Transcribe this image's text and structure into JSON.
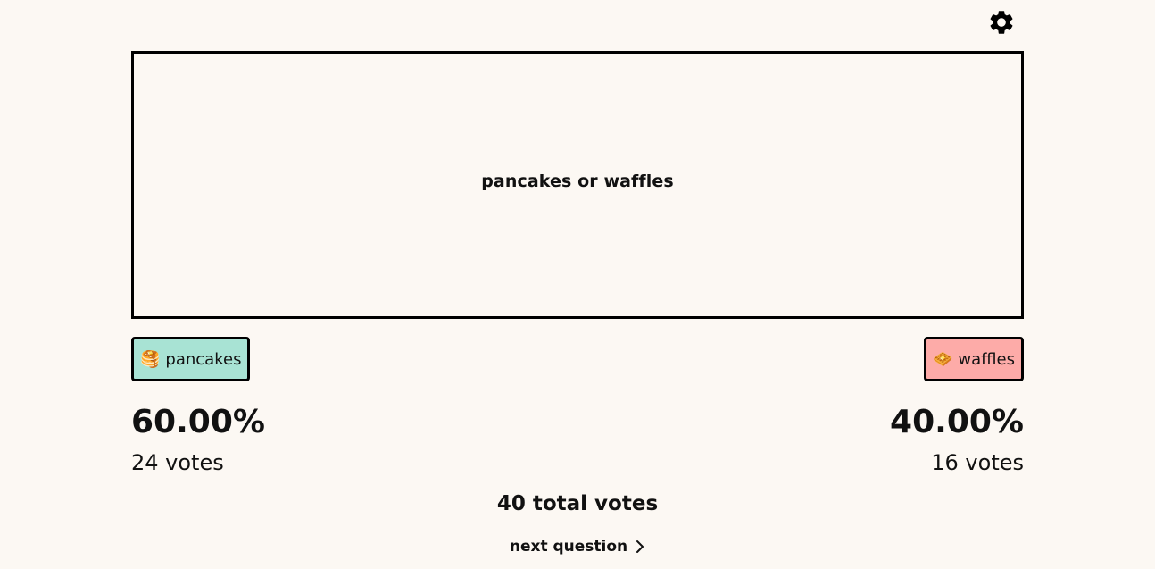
{
  "header": {
    "settings_icon": "gear-icon"
  },
  "question": {
    "text": "pancakes or waffles"
  },
  "options": [
    {
      "emoji": "🥞",
      "label": "pancakes",
      "color": "#a8e3d4",
      "percent": "60.00%",
      "votes": "24 votes"
    },
    {
      "emoji": "🧇",
      "label": "waffles",
      "color": "#fdaba8",
      "percent": "40.00%",
      "votes": "16 votes"
    }
  ],
  "total": "40 total votes",
  "next": {
    "label": "next question",
    "icon": "chevron-right-icon"
  }
}
